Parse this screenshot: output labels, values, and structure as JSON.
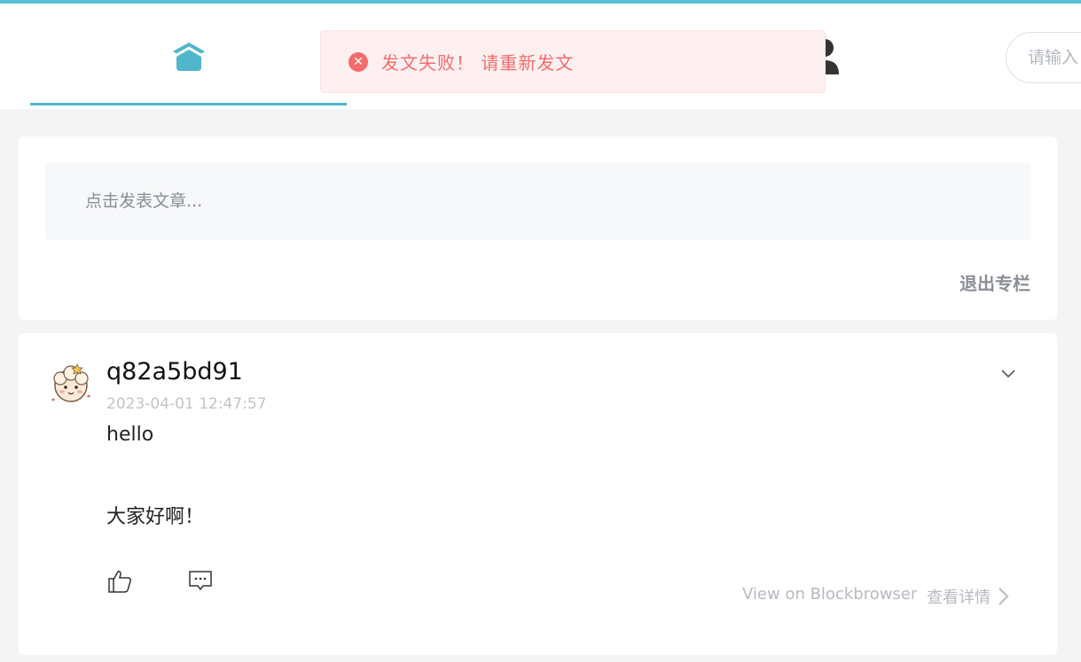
{
  "nav": {
    "home_icon": "home-icon",
    "user_icon": "user-icon",
    "search_placeholder": "请输入"
  },
  "toast": {
    "icon": "error-circle-icon",
    "message": "发文失败！ 请重新发文"
  },
  "compose": {
    "placeholder": "点击发表文章...",
    "exit_label": "退出专栏"
  },
  "post": {
    "avatar_icon": "sheep-avatar",
    "username": "q82a5bd91",
    "timestamp": "2023-04-01 12:47:57",
    "content_line1": "hello",
    "content_line2": "大家好啊！",
    "view_on_blockbrowser": "View on Blockbrowser",
    "details_label": "查看详情"
  },
  "colors": {
    "accent": "#4fb6cc",
    "error": "#f56c6c",
    "error_bg": "#fef0f0"
  }
}
